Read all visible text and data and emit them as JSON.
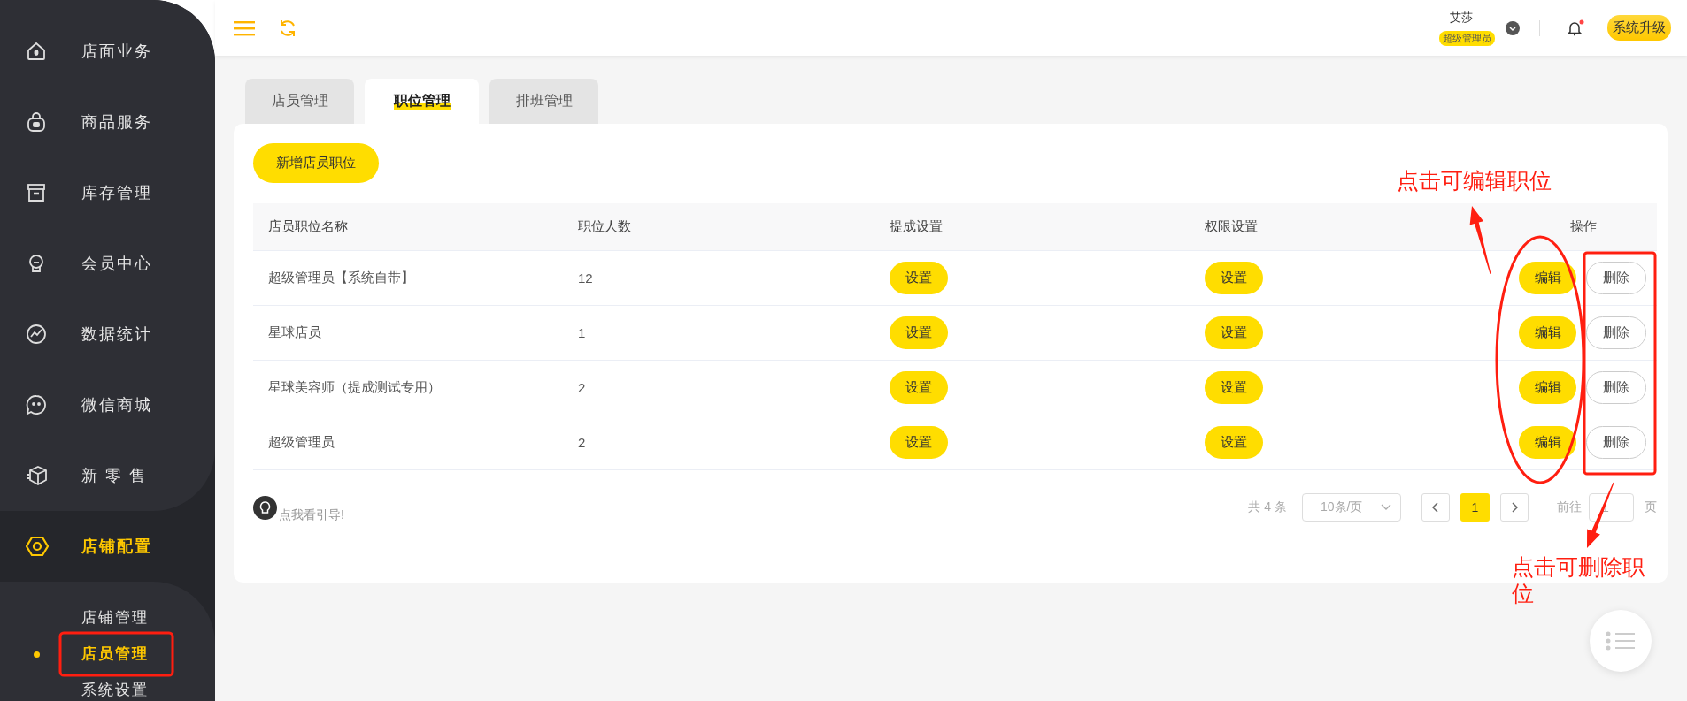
{
  "sidebar": {
    "items": [
      {
        "label": "店面业务",
        "selected": false
      },
      {
        "label": "商品服务",
        "selected": false
      },
      {
        "label": "库存管理",
        "selected": false
      },
      {
        "label": "会员中心",
        "selected": false
      },
      {
        "label": "数据统计",
        "selected": false
      },
      {
        "label": "微信商城",
        "selected": false
      },
      {
        "label": "新 零 售",
        "selected": false
      },
      {
        "label": "店铺配置",
        "selected": true,
        "children": [
          {
            "label": "店铺管理",
            "selected": false
          },
          {
            "label": "店员管理",
            "selected": true
          },
          {
            "label": "系统设置",
            "selected": false
          }
        ]
      }
    ]
  },
  "header": {
    "user_name": "艾莎",
    "role": "超级管理员",
    "upgrade_button": "系统升级"
  },
  "tabs": [
    {
      "label": "店员管理",
      "selected": false
    },
    {
      "label": "职位管理",
      "selected": true
    },
    {
      "label": "排班管理",
      "selected": false
    }
  ],
  "add_button": "新增店员职位",
  "table": {
    "columns": [
      "店员职位名称",
      "职位人数",
      "提成设置",
      "权限设置",
      "操作"
    ],
    "rows": [
      {
        "name": "超级管理员【系统自带】",
        "count": "12",
        "commission": "设置",
        "permission": "设置",
        "edit": "编辑",
        "delete": "删除"
      },
      {
        "name": "星球店员",
        "count": "1",
        "commission": "设置",
        "permission": "设置",
        "edit": "编辑",
        "delete": "删除"
      },
      {
        "name": "星球美容师（提成测试专用）",
        "count": "2",
        "commission": "设置",
        "permission": "设置",
        "edit": "编辑",
        "delete": "删除"
      },
      {
        "name": "超级管理员",
        "count": "2",
        "commission": "设置",
        "permission": "设置",
        "edit": "编辑",
        "delete": "删除"
      }
    ]
  },
  "guide_link": "点我看引导!",
  "pagination": {
    "total": "共 4 条",
    "page_size": "10条/页",
    "pages": [
      {
        "label": "1",
        "selected": true
      }
    ],
    "goto_label": "前往",
    "goto_value": "1",
    "goto_suffix": "页"
  },
  "annotations": [
    {
      "text": "点击可编辑职位"
    },
    {
      "text": "点击可删除职位"
    }
  ]
}
